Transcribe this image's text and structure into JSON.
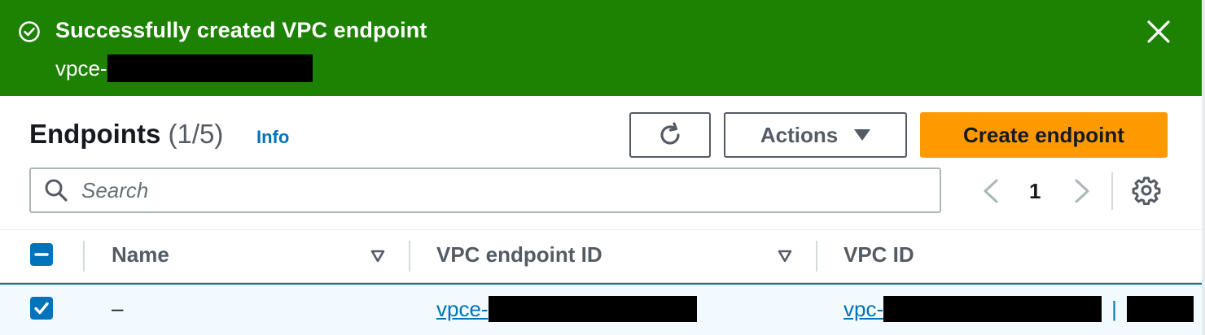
{
  "flash": {
    "title": "Successfully created VPC endpoint",
    "subtitle_prefix": "vpce-",
    "color": "#1d8102"
  },
  "header": {
    "title": "Endpoints",
    "count": "(1/5)",
    "info_label": "Info"
  },
  "toolbar": {
    "refresh_icon": "refresh-icon",
    "actions_label": "Actions",
    "create_label": "Create endpoint",
    "create_color": "#ff9900"
  },
  "search": {
    "placeholder": "Search"
  },
  "pagination": {
    "current_page": "1"
  },
  "table": {
    "columns": [
      {
        "label": "Name"
      },
      {
        "label": "VPC endpoint ID"
      },
      {
        "label": "VPC ID"
      }
    ],
    "rows": [
      {
        "selected": true,
        "name": "–",
        "endpoint_id_prefix": "vpce-",
        "vpc_id_prefix": "vpc-",
        "vpc_separator": "|"
      }
    ]
  },
  "colors": {
    "link": "#0073bb",
    "selected_row_bg": "#f1faff"
  }
}
